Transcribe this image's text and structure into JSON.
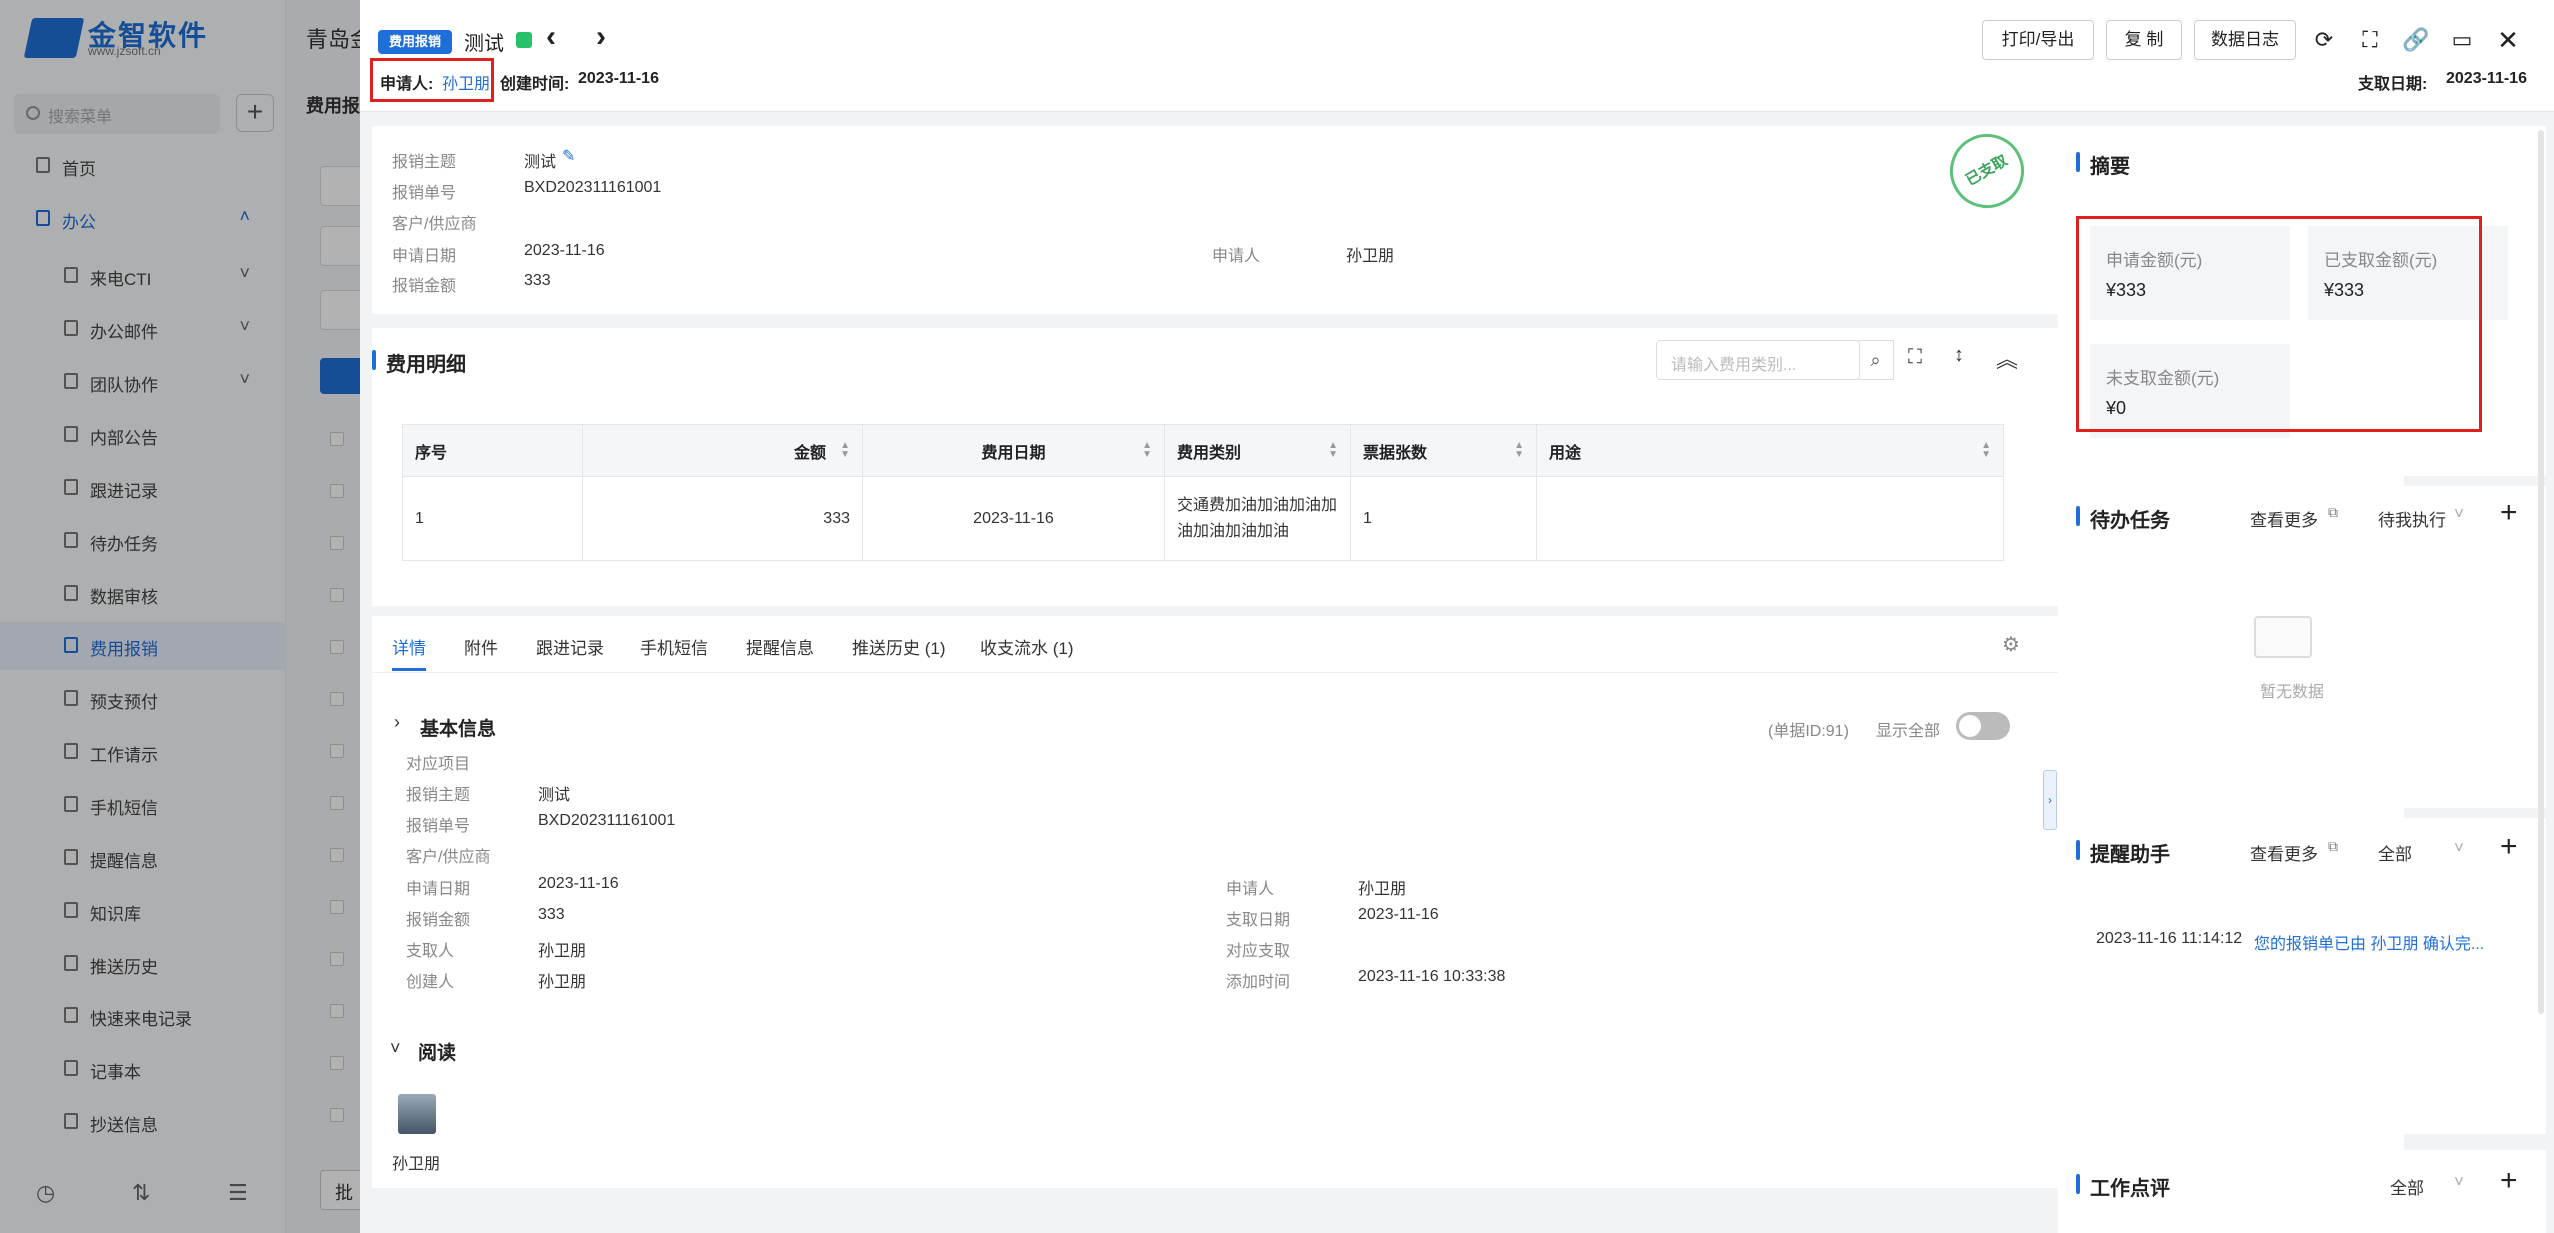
{
  "app": {
    "logo_text": "金智软件",
    "logo_sub": "www.jzsoft.cn",
    "search_placeholder": "搜索菜单",
    "nav": [
      {
        "label": "首页",
        "icon": "home-icon"
      },
      {
        "label": "办公",
        "icon": "office-icon"
      },
      {
        "label": "来电CTI",
        "icon": "copy-icon"
      },
      {
        "label": "办公邮件",
        "icon": "copy-icon"
      },
      {
        "label": "团队协作",
        "icon": "copy-icon"
      },
      {
        "label": "内部公告",
        "icon": "speaker-icon"
      },
      {
        "label": "跟进记录",
        "icon": "edit-icon"
      },
      {
        "label": "待办任务",
        "icon": "pin-icon"
      },
      {
        "label": "数据审核",
        "icon": "user-icon"
      },
      {
        "label": "费用报销",
        "icon": "list-icon"
      },
      {
        "label": "预支预付",
        "icon": "card-icon"
      },
      {
        "label": "工作请示",
        "icon": "doc-icon"
      },
      {
        "label": "手机短信",
        "icon": "chat-icon"
      },
      {
        "label": "提醒信息",
        "icon": "bell-icon"
      },
      {
        "label": "知识库",
        "icon": "book-icon"
      },
      {
        "label": "推送历史",
        "icon": "clock-icon"
      },
      {
        "label": "快速来电记录",
        "icon": "edit-icon"
      },
      {
        "label": "记事本",
        "icon": "note-icon"
      },
      {
        "label": "抄送信息",
        "icon": "send-icon"
      }
    ],
    "bg_title": "青岛金",
    "bg_subtitle": "费用报",
    "bg_footer_btn": "批"
  },
  "header": {
    "tag": "费用报销",
    "title": "测试",
    "applicant_label": "申请人:",
    "applicant": "孙卫朋",
    "created_label": "创建时间:",
    "created": "2023-11-16",
    "paid_label": "支取日期:",
    "paid": "2023-11-16",
    "buttons": [
      "打印/导出",
      "复 制",
      "数据日志"
    ]
  },
  "overview": {
    "rows": [
      {
        "label": "报销主题",
        "value": "测试"
      },
      {
        "label": "报销单号",
        "value": "BXD202311161001"
      },
      {
        "label": "客户/供应商",
        "value": ""
      },
      {
        "label": "申请日期",
        "value": "2023-11-16"
      },
      {
        "label": "报销金额",
        "value": "333"
      }
    ],
    "right_label": "申请人",
    "right_value": "孙卫朋",
    "stamp": "已支取"
  },
  "detail": {
    "title": "费用明细",
    "search_placeholder": "请输入费用类别...",
    "columns": [
      "序号",
      "金额",
      "费用日期",
      "费用类别",
      "票据张数",
      "用途"
    ],
    "rows": [
      [
        "1",
        "333",
        "2023-11-16",
        "交通费加油加油加油加油加油加油加油",
        "1",
        ""
      ]
    ]
  },
  "tabs": [
    "详情",
    "附件",
    "跟进记录",
    "手机短信",
    "提醒信息",
    "推送历史 (1)",
    "收支流水 (1)"
  ],
  "basic": {
    "title": "基本信息",
    "doc_id": "(单据ID:91)",
    "show_all": "显示全部",
    "left": [
      {
        "label": "对应项目",
        "value": ""
      },
      {
        "label": "报销主题",
        "value": "测试"
      },
      {
        "label": "报销单号",
        "value": "BXD202311161001"
      },
      {
        "label": "客户/供应商",
        "value": ""
      },
      {
        "label": "申请日期",
        "value": "2023-11-16"
      },
      {
        "label": "报销金额",
        "value": "333"
      },
      {
        "label": "支取人",
        "value": "孙卫朋"
      },
      {
        "label": "创建人",
        "value": "孙卫朋"
      }
    ],
    "right": [
      {
        "label": "申请人",
        "value": "孙卫朋"
      },
      {
        "label": "支取日期",
        "value": "2023-11-16"
      },
      {
        "label": "对应支取",
        "value": ""
      },
      {
        "label": "添加时间",
        "value": "2023-11-16 10:33:38"
      }
    ]
  },
  "read": {
    "title": "阅读",
    "user": "孙卫朋"
  },
  "summary": {
    "title": "摘要",
    "items": [
      {
        "label": "申请金额(元)",
        "value": "¥333"
      },
      {
        "label": "已支取金额(元)",
        "value": "¥333"
      },
      {
        "label": "未支取金额(元)",
        "value": "¥0"
      }
    ]
  },
  "todo": {
    "title": "待办任务",
    "more": "查看更多",
    "filter": "待我执行",
    "empty": "暂无数据"
  },
  "reminder": {
    "title": "提醒助手",
    "more": "查看更多",
    "filter": "全部",
    "time": "2023-11-16 11:14:12",
    "text": "您的报销单已由 孙卫朋 确认完..."
  },
  "review": {
    "title": "工作点评",
    "filter": "全部"
  },
  "colors": {
    "accent": "#1f6fd8",
    "highlight": "#e02020",
    "stamp": "#5cc07b"
  }
}
